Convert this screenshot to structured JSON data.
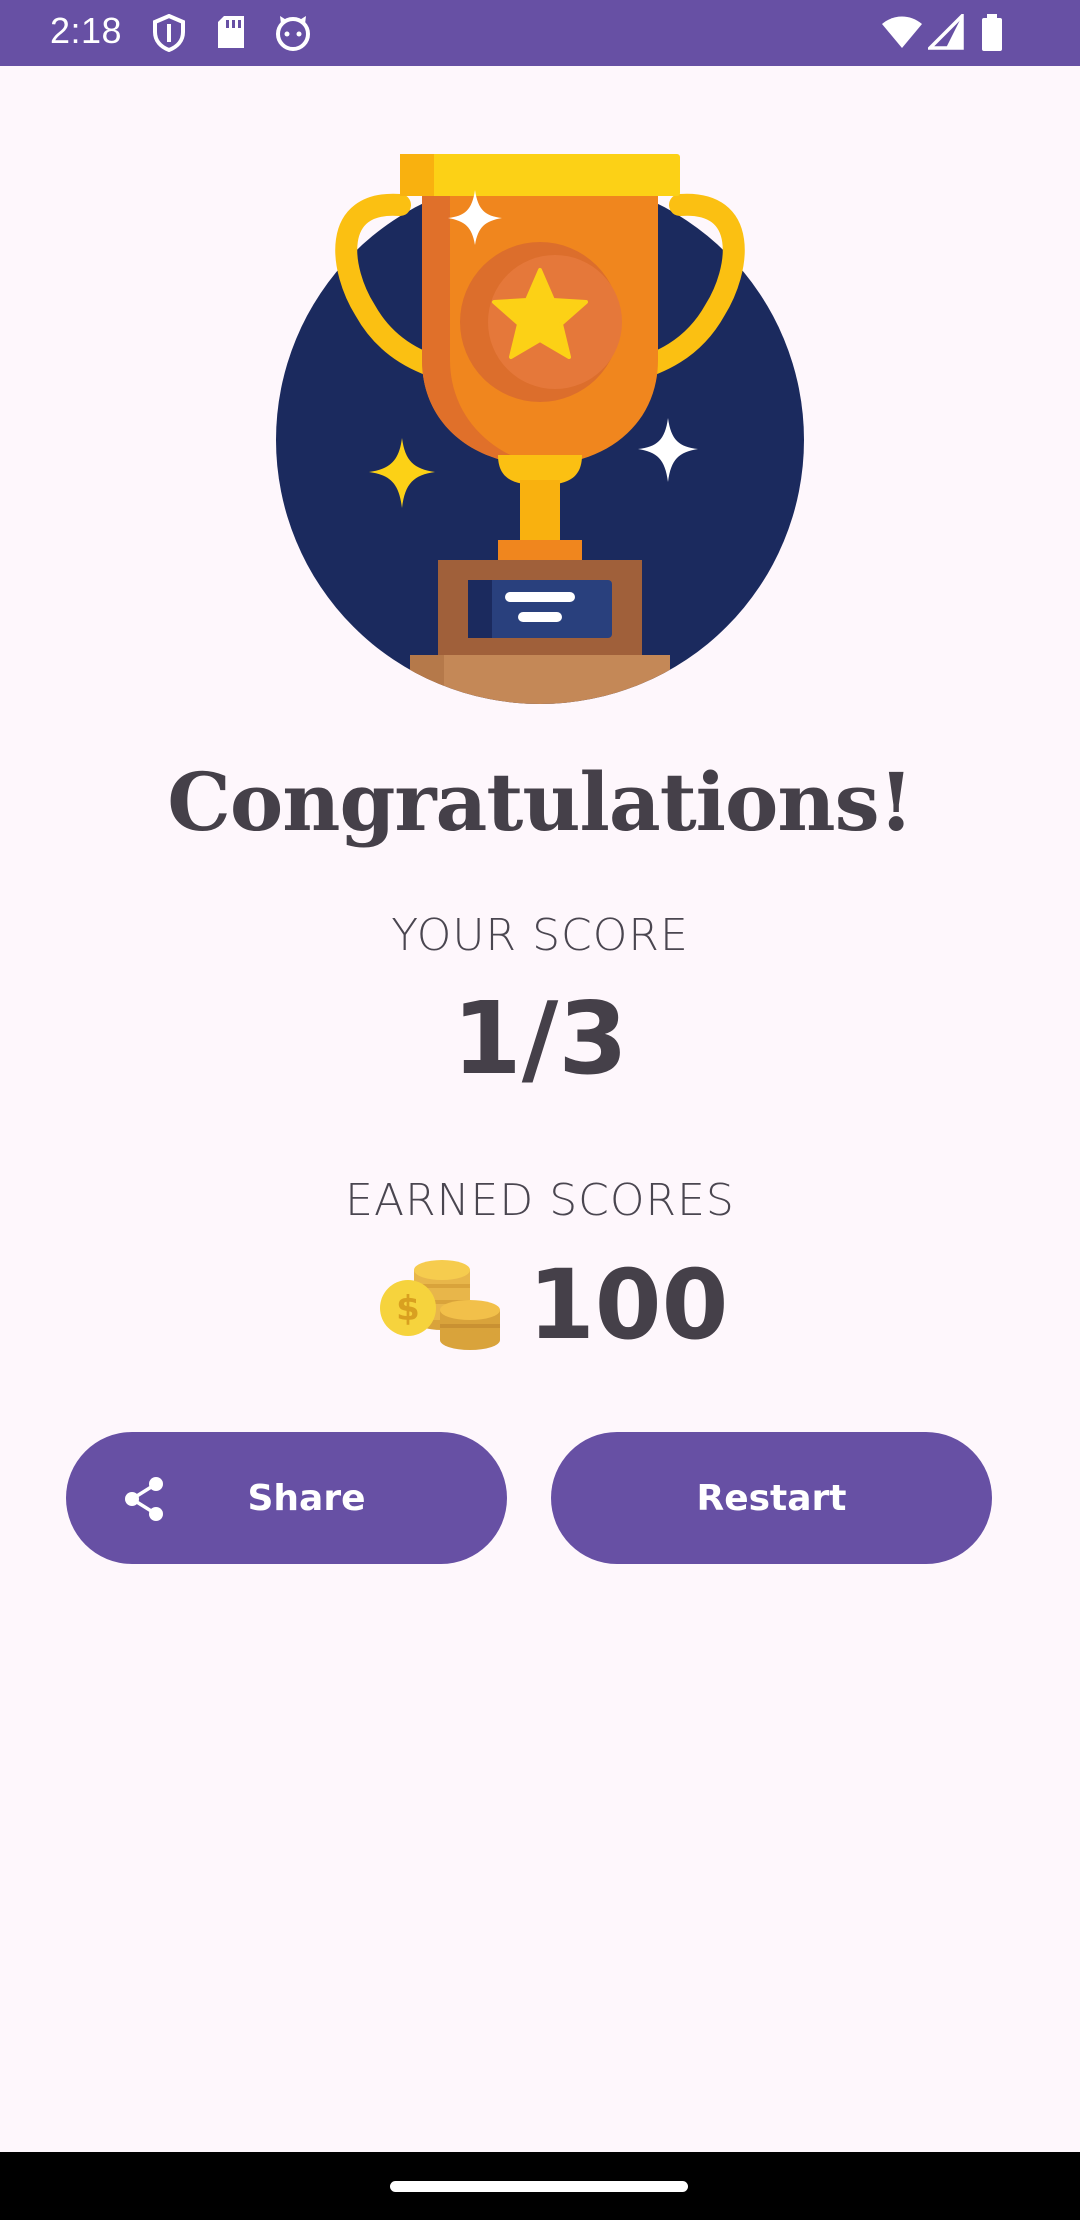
{
  "status_bar": {
    "time": "2:18",
    "icons": [
      "shield-icon",
      "sd-card-icon",
      "cat-icon",
      "wifi-icon",
      "signal-icon",
      "battery-icon"
    ]
  },
  "result": {
    "title": "Congratulations!",
    "your_score_label": "YOUR SCORE",
    "your_score_value": "1/3",
    "earned_label": "EARNED SCORES",
    "earned_value": "100"
  },
  "buttons": {
    "share_label": "Share",
    "restart_label": "Restart"
  },
  "colors": {
    "primary": "#6750A4",
    "background": "#FEF7FC",
    "text": "#454049",
    "trophy_circle": "#1B2A5E",
    "trophy_gold": "#F0861E"
  }
}
